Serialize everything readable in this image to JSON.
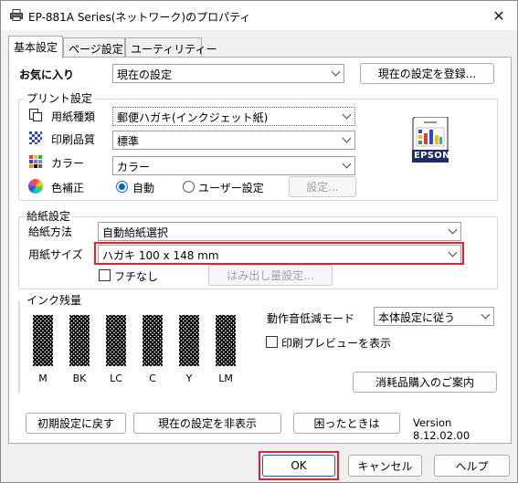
{
  "window": {
    "title": "EP-881A Series(ネットワーク)のプロパティ",
    "close_glyph": "✕"
  },
  "tabs": [
    {
      "label": "基本設定"
    },
    {
      "label": "ページ設定"
    },
    {
      "label": "ユーティリティー"
    }
  ],
  "favorites": {
    "label": "お気に入り",
    "value": "現在の設定",
    "register_button": "現在の設定を登録..."
  },
  "print_settings": {
    "group_label": "プリント設定",
    "paper_type": {
      "label": "用紙種類",
      "value": "郵便ハガキ(インクジェット紙)"
    },
    "quality": {
      "label": "印刷品質",
      "value": "標準"
    },
    "color": {
      "label": "カラー",
      "value": "カラー"
    },
    "color_correction": {
      "label": "色補正",
      "auto": "自動",
      "user": "ユーザー設定",
      "settings_button": "設定..."
    },
    "preview_brand": "EPSON"
  },
  "feed_settings": {
    "group_label": "給紙設定",
    "source": {
      "label": "給紙方法",
      "value": "自動給紙選択"
    },
    "size": {
      "label": "用紙サイズ",
      "value": "ハガキ 100 x 148 mm"
    },
    "borderless": {
      "label": "フチなし",
      "checked": false
    },
    "overflow_button": "はみ出し量設定..."
  },
  "ink": {
    "group_label": "インク残量",
    "colors": [
      "M",
      "BK",
      "LC",
      "C",
      "Y",
      "LM"
    ]
  },
  "quiet_mode": {
    "label": "動作音低減モード",
    "value": "本体設定に従う"
  },
  "print_preview": {
    "label": "印刷プレビューを表示",
    "checked": false
  },
  "supplies_button": "消耗品購入のご案内",
  "bottom": {
    "reset_button": "初期設定に戻す",
    "hide_button": "現在の設定を非表示",
    "help_trouble_button": "困ったときは",
    "version": "Version 8.12.02.00"
  },
  "dialog": {
    "ok": "OK",
    "cancel": "キャンセル",
    "help": "ヘルプ"
  },
  "colors": {
    "accent": "#0067c0",
    "highlight": "#e3202b"
  }
}
